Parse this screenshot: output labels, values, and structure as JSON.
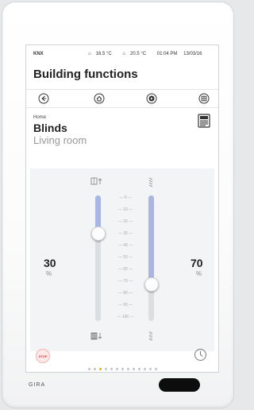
{
  "status": {
    "bus": "KNX",
    "temp_outdoor": "16.5 °C",
    "temp_indoor": "20.5 °C",
    "time": "01:04 PM",
    "date": "13/03/16"
  },
  "header": {
    "title": "Building functions"
  },
  "breadcrumb": {
    "label": "Home"
  },
  "page": {
    "title": "Blinds",
    "room": "Living room"
  },
  "blind_position": {
    "value": "30",
    "unit": "%",
    "level": 30
  },
  "slat_position": {
    "value": "70",
    "unit": "%",
    "level": 70
  },
  "scale": [
    "0",
    "10",
    "20",
    "30",
    "40",
    "50",
    "60",
    "70",
    "80",
    "90",
    "100"
  ],
  "buttons": {
    "stop_label": "STOP"
  },
  "pagination": {
    "pages": 13,
    "active": 2
  },
  "brand": "GIRA",
  "colors": {
    "accent_fill": "#a9b6e3",
    "stop_red": "#d83a3a",
    "active_dot": "#e9b100"
  },
  "icons": [
    "back-icon",
    "home-icon",
    "play-icon",
    "grid-icon",
    "document-icon",
    "blind-up-icon",
    "blind-down-icon",
    "slat-open-icon",
    "slat-closed-icon",
    "timer-icon"
  ]
}
